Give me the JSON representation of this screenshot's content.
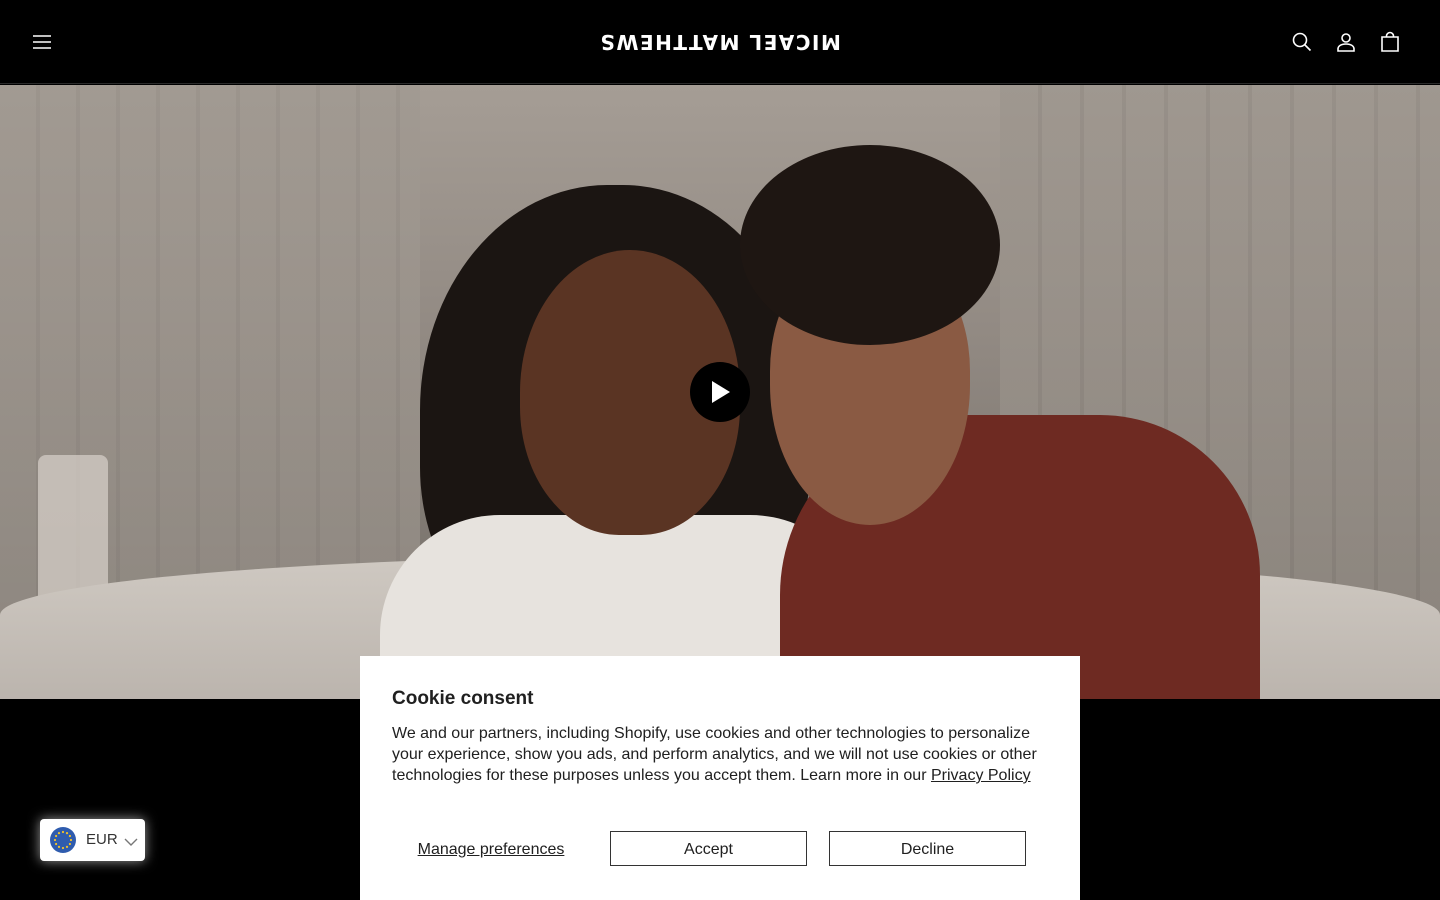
{
  "header": {
    "logo_text": "MICAEL MATTHEWS",
    "icons": [
      "menu-icon",
      "search-icon",
      "account-icon",
      "cart-icon"
    ]
  },
  "hero": {
    "play_icon": "play-icon"
  },
  "cookie": {
    "title": "Cookie consent",
    "body": "We and our partners, including Shopify, use cookies and other technologies to personalize your experience, show you ads, and perform analytics, and we will not use cookies or other technologies for these purposes unless you accept them. Learn more in our ",
    "link": "Privacy Policy",
    "manage": "Manage preferences",
    "accept": "Accept",
    "decline": "Decline"
  },
  "currency": {
    "code": "EUR",
    "flag_icon": "eu-flag-icon"
  },
  "colors": {
    "background": "#000000",
    "modal": "#ffffff",
    "text_dark": "#202020"
  }
}
